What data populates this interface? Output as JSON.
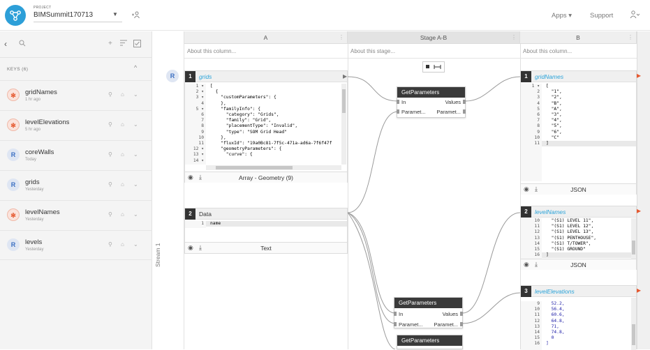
{
  "header": {
    "project_label": "PROJECT",
    "project_name": "BIMSummit170713",
    "nav": {
      "apps": "Apps ▾",
      "support": "Support"
    }
  },
  "sidebar": {
    "keys_heading": "KEYS (6)",
    "keys": [
      {
        "name": "gridNames",
        "time": "1 hr ago",
        "type": "s"
      },
      {
        "name": "levelElevations",
        "time": "5 hr ago",
        "type": "s"
      },
      {
        "name": "coreWalls",
        "time": "Today",
        "type": "r"
      },
      {
        "name": "grids",
        "time": "Yesterday",
        "type": "r"
      },
      {
        "name": "levelNames",
        "time": "Yesterday",
        "type": "s"
      },
      {
        "name": "levels",
        "time": "Yesterday",
        "type": "r"
      }
    ]
  },
  "stream_label": "Stream 1",
  "columns": {
    "a": {
      "title": "A",
      "about": "About this column..."
    },
    "stage": {
      "title": "Stage A-B",
      "about": "About this stage..."
    },
    "b": {
      "title": "B",
      "about": "About this column..."
    }
  },
  "cells": {
    "a1": {
      "num": "1",
      "title": "grids",
      "footer": "Array - Geometry (9)",
      "gutter": "1 ▾\n2 ▾\n3 ▾\n4\n5 ▾\n6\n7\n8\n9\n10\n11\n12 ▾\n13 ▾\n14 ▾",
      "code": "[\n  {\n    \"customParameters\": {\n    },\n    \"familyInfo\": {\n      \"category\": \"Grids\",\n      \"family\": \"Grid\",\n      \"placementType\": \"Invalid\",\n      \"type\": \"SOM Grid Head\"\n    },\n    \"fluxId\": \"19a0Bc81-7f5c-471a-ad6a-7f6f47f\n    \"geometryParameters\": {\n      \"curve\": {"
    },
    "a2": {
      "num": "2",
      "title": "Data",
      "footer": "Text",
      "gutter": "1",
      "code": "name"
    },
    "b1": {
      "num": "1",
      "title": "gridNames",
      "footer": "JSON",
      "gutter": "1 ▾\n2\n3\n4\n5\n6\n7\n8\n9\n10\n11",
      "code": "[\n  \"1\",\n  \"2\",\n  \"B\",\n  \"A\",\n  \"3\",\n  \"4\",\n  \"5\",\n  \"6\",\n  \"C\"\n]"
    },
    "b2": {
      "num": "2",
      "title": "levelNames",
      "footer": "JSON",
      "gutter": "10\n11\n12\n13\n14\n15\n16",
      "code": "  \"(S1) LEVEL 11\",\n  \"(S1) LEVEL 12\",\n  \"(S1) LEVEL 13\",\n  \"(S1) PENTHOUSE\",\n  \"(S1) T/TOWER\",\n  \"(S1) GROUND\"\n]"
    },
    "b3": {
      "num": "3",
      "title": "levelElevations",
      "gutter": "9\n10\n11\n12\n13\n14\n15\n16",
      "code": "  52.2,\n  56.4,\n  60.6,\n  64.8,\n  71,\n  74.8,\n  0\n]"
    }
  },
  "nodes": {
    "n1": {
      "title": "GetParameters",
      "in": "In",
      "values": "Values",
      "param_in": "Paramet...",
      "param_out": "Paramet..."
    },
    "n2": {
      "title": "GetParameters",
      "in": "In",
      "values": "Values",
      "param_in": "Paramet...",
      "param_out": "Paramet..."
    },
    "n3": {
      "title": "GetParameters"
    }
  }
}
